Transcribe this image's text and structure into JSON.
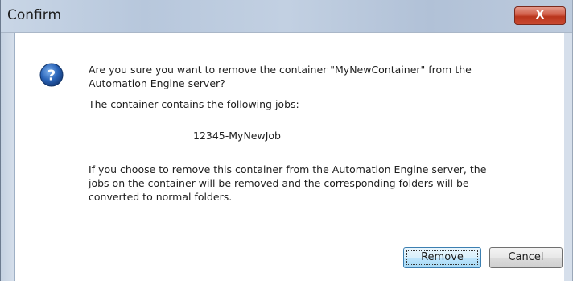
{
  "window": {
    "title": "Confirm",
    "close_label": "X"
  },
  "dialog": {
    "icon": "question-icon",
    "message_line1": "Are you sure you want to remove the container \"MyNewContainer\" from the",
    "message_line2": "Automation Engine server?",
    "jobs_intro": "The container contains the following jobs:",
    "job_name": "12345-MyNewJob",
    "warning_line1": "If you choose to remove this container from the Automation Engine server, the",
    "warning_line2": "jobs on the container will be removed and the corresponding folders will be",
    "warning_line3": "converted to normal folders."
  },
  "buttons": {
    "remove_label": "Remove",
    "cancel_label": "Cancel"
  },
  "colors": {
    "close_button": "#c94a31",
    "icon_blue": "#2a64b8",
    "default_button_border": "#3c7fb1"
  }
}
